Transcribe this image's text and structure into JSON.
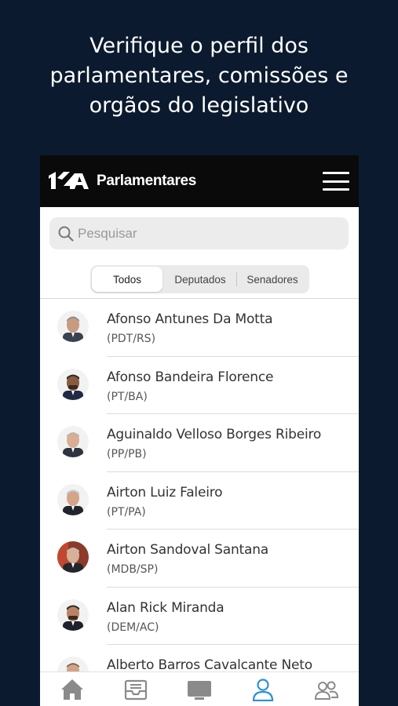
{
  "headline": {
    "line1": "Verifique o perfil dos",
    "line2": "parlamentares, comissões e",
    "line3": "orgãos do legislativo"
  },
  "appbar": {
    "title": "Parlamentares"
  },
  "search": {
    "placeholder": "Pesquisar"
  },
  "segments": [
    "Todos",
    "Deputados",
    "Senadores"
  ],
  "segments_active": "Todos",
  "members": [
    {
      "name": "Afonso Antunes Da Motta",
      "party": "(PDT/RS)"
    },
    {
      "name": "Afonso Bandeira Florence",
      "party": "(PT/BA)"
    },
    {
      "name": "Aguinaldo Velloso Borges Ribeiro",
      "party": "(PP/PB)"
    },
    {
      "name": "Airton Luiz Faleiro",
      "party": "(PT/PA)"
    },
    {
      "name": "Airton Sandoval Santana",
      "party": "(MDB/SP)"
    },
    {
      "name": "Alan Rick Miranda",
      "party": "(DEM/AC)"
    },
    {
      "name": "Alberto Barros Cavalcante Neto",
      "party": ""
    }
  ],
  "tabbar": [
    "home-icon",
    "inbox-icon",
    "tv-icon",
    "person-icon",
    "people-icon"
  ],
  "colors": {
    "background": "#0b1a2e",
    "appbar": "#0a0a0a",
    "accent": "#2d8fd6",
    "tab_inactive": "#8a8a8a"
  }
}
